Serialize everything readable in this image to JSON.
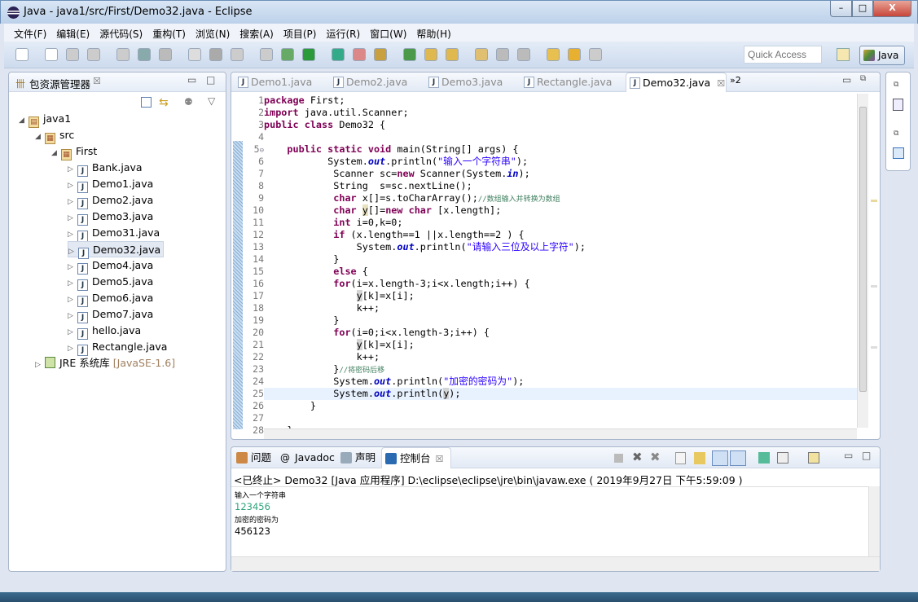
{
  "window": {
    "title": "Java  - java1/src/First/Demo32.java  - Eclipse",
    "minimize": "–",
    "maximize": "□",
    "close": "X"
  },
  "menu": [
    "文件(F)",
    "编辑(E)",
    "源代码(S)",
    "重构(T)",
    "浏览(N)",
    "搜索(A)",
    "项目(P)",
    "运行(R)",
    "窗口(W)",
    "帮助(H)"
  ],
  "toolbar": {
    "quick_access_placeholder": "Quick Access",
    "perspective": "Java"
  },
  "explorer": {
    "title": "包资源管理器",
    "close": "☒",
    "tree": [
      {
        "label": "java1",
        "depth": 0,
        "open": true,
        "icon": "project-icon"
      },
      {
        "label": "src",
        "depth": 1,
        "open": true,
        "icon": "source-folder-icon"
      },
      {
        "label": "First",
        "depth": 2,
        "open": true,
        "icon": "package-icon"
      },
      {
        "label": "Bank.java",
        "depth": 3,
        "icon": "java-file-icon"
      },
      {
        "label": "Demo1.java",
        "depth": 3,
        "icon": "java-file-icon"
      },
      {
        "label": "Demo2.java",
        "depth": 3,
        "icon": "java-file-icon"
      },
      {
        "label": "Demo3.java",
        "depth": 3,
        "icon": "java-file-icon"
      },
      {
        "label": "Demo31.java",
        "depth": 3,
        "icon": "java-file-icon"
      },
      {
        "label": "Demo32.java",
        "depth": 3,
        "icon": "java-file-icon",
        "selected": true
      },
      {
        "label": "Demo4.java",
        "depth": 3,
        "icon": "java-file-icon"
      },
      {
        "label": "Demo5.java",
        "depth": 3,
        "icon": "java-file-icon"
      },
      {
        "label": "Demo6.java",
        "depth": 3,
        "icon": "java-file-icon"
      },
      {
        "label": "Demo7.java",
        "depth": 3,
        "icon": "java-file-icon"
      },
      {
        "label": "hello.java",
        "depth": 3,
        "icon": "java-file-icon"
      },
      {
        "label": "Rectangle.java",
        "depth": 3,
        "icon": "java-file-icon"
      }
    ],
    "jre": {
      "label": "JRE 系统库",
      "version": "[JavaSE-1.6]"
    }
  },
  "editor": {
    "tabs": [
      "Demo1.java",
      "Demo2.java",
      "Demo3.java",
      "Rectangle.java",
      "Demo32.java"
    ],
    "active_tab": "Demo32.java",
    "overflow": "»2",
    "lines": [
      [
        [
          "package",
          "kw"
        ],
        [
          " First;",
          ""
        ]
      ],
      [
        [
          "import",
          "kw"
        ],
        [
          " java.util.Scanner;",
          ""
        ]
      ],
      [
        [
          "public class",
          "kw"
        ],
        [
          " Demo32 {",
          ""
        ]
      ],
      [],
      [
        [
          "    ",
          ""
        ],
        [
          "public static void",
          "kw"
        ],
        [
          " main(String[] args) {",
          ""
        ]
      ],
      [
        [
          "           System.",
          ""
        ],
        [
          "out",
          "fld"
        ],
        [
          ".println(",
          ""
        ],
        [
          "\"输入一个字符串\"",
          "str"
        ],
        [
          ");",
          ""
        ]
      ],
      [
        [
          "            Scanner sc=",
          ""
        ],
        [
          "new",
          "kw"
        ],
        [
          " Scanner(System.",
          ""
        ],
        [
          "in",
          "fld"
        ],
        [
          ");",
          ""
        ]
      ],
      [
        [
          "            String  s=sc.nextLine();",
          ""
        ]
      ],
      [
        [
          "            ",
          ""
        ],
        [
          "char",
          "kw"
        ],
        [
          " x[]=s.toCharArray();",
          ""
        ],
        [
          "//数组输入并转换为数组",
          "cm"
        ]
      ],
      [
        [
          "            ",
          ""
        ],
        [
          "char",
          "kw"
        ],
        [
          " ",
          ""
        ],
        [
          "y",
          "occ"
        ],
        [
          "[]=",
          ""
        ],
        [
          "new char",
          "kw"
        ],
        [
          " [x.length];",
          ""
        ]
      ],
      [
        [
          "            ",
          ""
        ],
        [
          "int",
          "kw"
        ],
        [
          " i=0,k=0;",
          ""
        ]
      ],
      [
        [
          "            ",
          ""
        ],
        [
          "if",
          "kw"
        ],
        [
          " (x.length==1 ||x.length==2 ) {",
          ""
        ]
      ],
      [
        [
          "                System.",
          ""
        ],
        [
          "out",
          "fld"
        ],
        [
          ".println(",
          ""
        ],
        [
          "\"请输入三位及以上字符\"",
          "str"
        ],
        [
          ");",
          ""
        ]
      ],
      [
        [
          "            }",
          ""
        ]
      ],
      [
        [
          "            ",
          ""
        ],
        [
          "else",
          "kw"
        ],
        [
          " {",
          ""
        ]
      ],
      [
        [
          "            ",
          ""
        ],
        [
          "for",
          "kw"
        ],
        [
          "(i=x.length-3;i<x.length;i++) {",
          ""
        ]
      ],
      [
        [
          "                ",
          ""
        ],
        [
          "y",
          "occ2"
        ],
        [
          "[k]=x[i];",
          ""
        ]
      ],
      [
        [
          "                k++;",
          ""
        ]
      ],
      [
        [
          "            }",
          ""
        ]
      ],
      [
        [
          "            ",
          ""
        ],
        [
          "for",
          "kw"
        ],
        [
          "(i=0;i<x.length-3;i++) {",
          ""
        ]
      ],
      [
        [
          "                ",
          ""
        ],
        [
          "y",
          "occ2"
        ],
        [
          "[k]=x[i];",
          ""
        ]
      ],
      [
        [
          "                k++;",
          ""
        ]
      ],
      [
        [
          "            }",
          ""
        ],
        [
          "//将密码后移",
          "cm"
        ]
      ],
      [
        [
          "            System.",
          ""
        ],
        [
          "out",
          "fld"
        ],
        [
          ".println(",
          ""
        ],
        [
          "\"加密的密码为\"",
          "str"
        ],
        [
          ");",
          ""
        ]
      ],
      [
        [
          "            System.",
          ""
        ],
        [
          "out",
          "fld"
        ],
        [
          ".println(",
          ""
        ],
        [
          "y",
          "occ2"
        ],
        [
          ");",
          ""
        ]
      ],
      [
        [
          "        }",
          ""
        ]
      ],
      [],
      [
        [
          "    }",
          ""
        ]
      ]
    ],
    "current_line": 25
  },
  "console": {
    "tabs": [
      {
        "label": "问题",
        "icon": "problems-icon"
      },
      {
        "label": "Javadoc",
        "icon": "at-icon"
      },
      {
        "label": "声明",
        "icon": "declaration-icon"
      },
      {
        "label": "控制台",
        "icon": "console-icon",
        "active": true
      }
    ],
    "status": "<已终止> Demo32 [Java 应用程序] D:\\eclipse\\eclipse\\jre\\bin\\javaw.exe ( 2019年9月27日 下午5:59:09 )",
    "output": [
      {
        "text": "输入一个字符串",
        "type": "out",
        "small": true
      },
      {
        "text": "123456",
        "type": "in"
      },
      {
        "text": "加密的密码为",
        "type": "out",
        "small": true
      },
      {
        "text": "456123",
        "type": "out"
      }
    ]
  },
  "colors": {
    "keyword": "#7f0055",
    "string": "#2a00ff",
    "comment": "#3f7f5f",
    "field": "#0000c0",
    "console_input": "#2fa37a"
  }
}
